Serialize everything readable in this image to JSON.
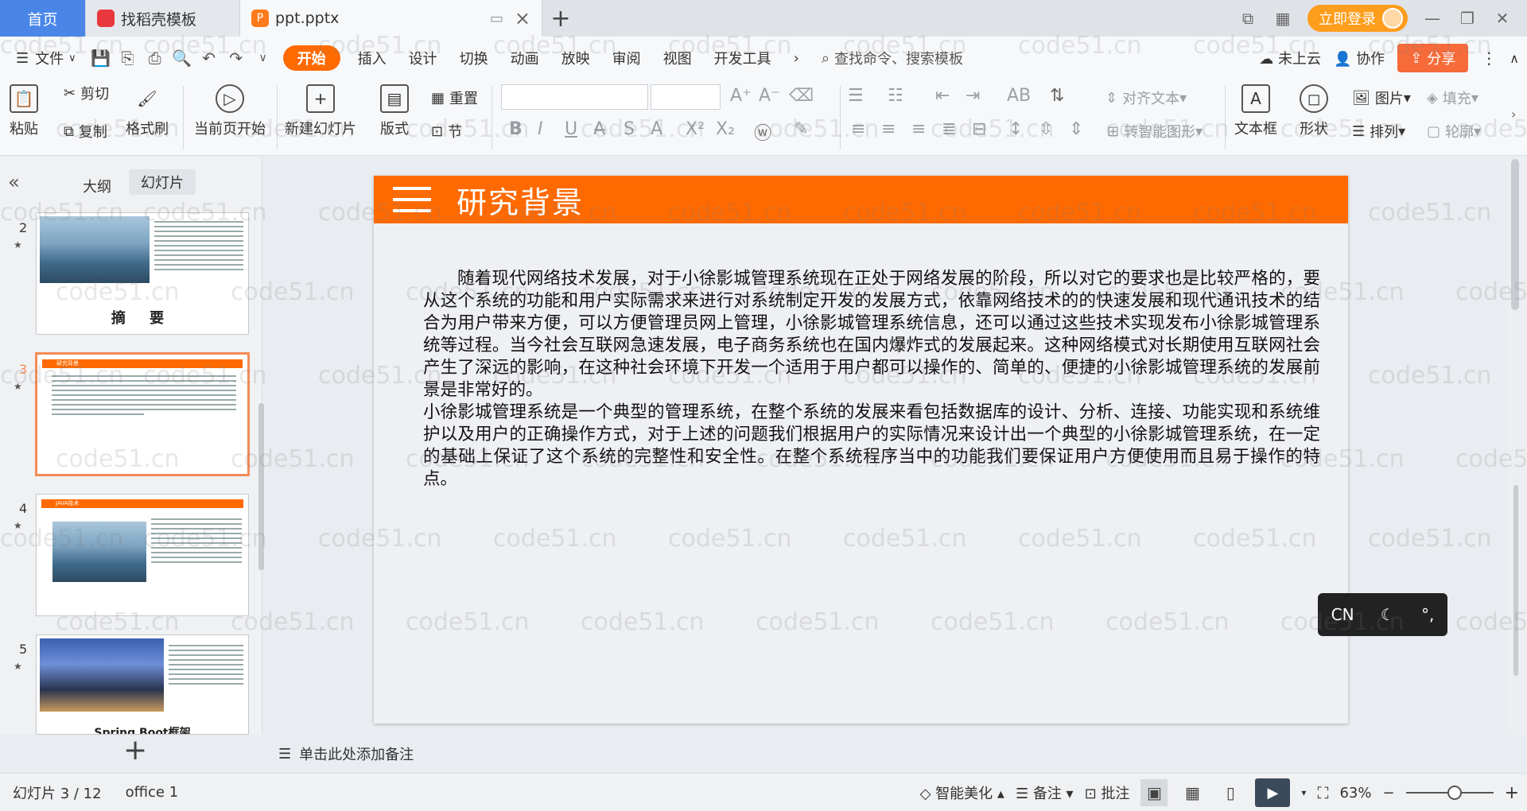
{
  "tabs": {
    "home": "首页",
    "daoke": "找稻壳模板",
    "doc": "ppt.pptx",
    "new": "+"
  },
  "account": {
    "login": "立即登录"
  },
  "menu": {
    "file": "文件",
    "items": [
      "开始",
      "插入",
      "设计",
      "切换",
      "动画",
      "放映",
      "审阅",
      "视图",
      "开发工具"
    ],
    "search": "查找命令、搜索模板",
    "cloud": "未上云",
    "collab": "协作",
    "share": "分享"
  },
  "ribbon": {
    "paste": "粘贴",
    "cut": "剪切",
    "copy": "复制",
    "format_painter": "格式刷",
    "play_from_current": "当前页开始",
    "new_slide": "新建幻灯片",
    "layout": "版式",
    "section": "节",
    "reset": "重置",
    "align_text": "对齐文本",
    "smartart": "转智能图形",
    "textbox": "文本框",
    "shape": "形状",
    "arrange": "排列",
    "picture": "图片",
    "fill": "填充",
    "outline": "轮廓"
  },
  "panel": {
    "outline_tab": "大纲",
    "slides_tab": "幻灯片",
    "collapse": "«",
    "add": "+"
  },
  "thumbs": [
    {
      "num": "2",
      "title": "摘 要"
    },
    {
      "num": "3",
      "bar": "研究背景"
    },
    {
      "num": "4",
      "bar": "JAVA技术"
    },
    {
      "num": "5",
      "title": "Spring Boot框架"
    }
  ],
  "slide": {
    "title": "研究背景",
    "para1": "随着现代网络技术发展，对于小徐影城管理系统现在正处于网络发展的阶段，所以对它的要求也是比较严格的，要从这个系统的功能和用户实际需求来进行对系统制定开发的发展方式，依靠网络技术的的快速发展和现代通讯技术的结合为用户带来方便，可以方便管理员网上管理，小徐影城管理系统信息，还可以通过这些技术实现发布小徐影城管理系统等过程。当今社会互联网急速发展，电子商务系统也在国内爆炸式的发展起来。这种网络模式对长期使用互联网社会产生了深远的影响，在这种社会环境下开发一个适用于用户都可以操作的、简单的、便捷的小徐影城管理系统的发展前景是非常好的。",
    "para2": "小徐影城管理系统是一个典型的管理系统，在整个系统的发展来看包括数据库的设计、分析、连接、功能实现和系统维护以及用户的正确操作方式，对于上述的问题我们根据用户的实际情况来设计出一个典型的小徐影城管理系统，在一定的基础上保证了这个系统的完整性和安全性。在整个系统程序当中的功能我们要保证用户方便使用而且易于操作的特点。"
  },
  "ime": {
    "lang": "CN",
    "moon": "☾",
    "dot": "°,"
  },
  "notes": {
    "placeholder": "单击此处添加备注"
  },
  "status": {
    "slide_count": "幻灯片 3 / 12",
    "theme": "office 1",
    "beautify": "智能美化",
    "notes": "备注",
    "comment": "批注",
    "zoom": "63%"
  },
  "watermark": "code51.cn",
  "colors": {
    "accent": "#ff6a00",
    "home_tab": "#4a86e8"
  }
}
